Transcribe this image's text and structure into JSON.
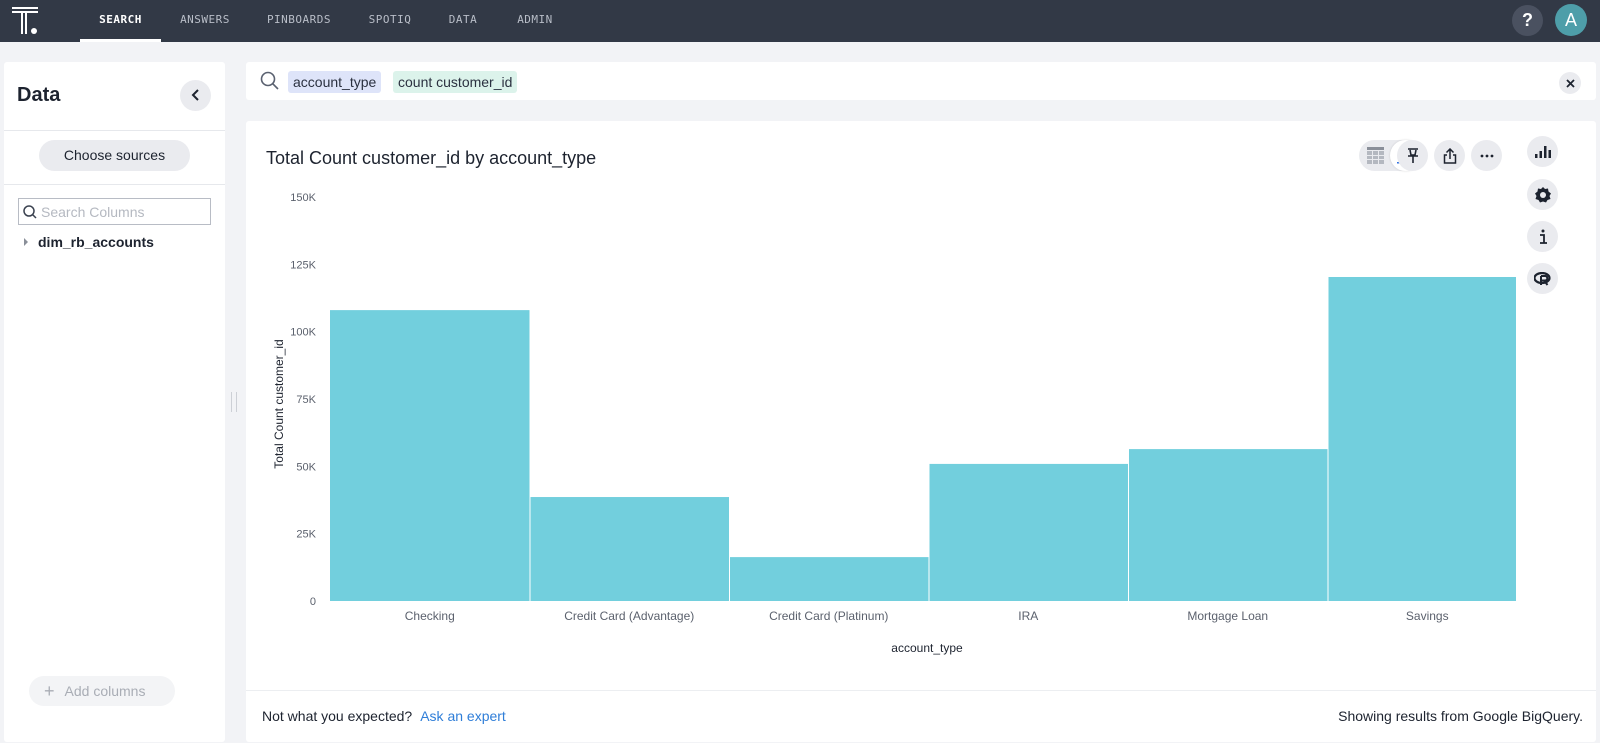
{
  "topnav": {
    "tabs": [
      {
        "label": "SEARCH",
        "active": true
      },
      {
        "label": "ANSWERS",
        "active": false
      },
      {
        "label": "PINBOARDS",
        "active": false
      },
      {
        "label": "SPOTIQ",
        "active": false
      },
      {
        "label": "DATA",
        "active": false
      },
      {
        "label": "ADMIN",
        "active": false
      }
    ],
    "help_label": "?",
    "avatar_initial": "A"
  },
  "sidebar": {
    "title": "Data",
    "choose_sources_label": "Choose sources",
    "search_placeholder": "Search Columns",
    "search_value": "",
    "tree_items": [
      {
        "label": "dim_rb_accounts"
      }
    ],
    "add_columns_label": "Add columns"
  },
  "searchbar": {
    "tokens": [
      {
        "label": "account_type",
        "kind": "attribute"
      },
      {
        "label": "count customer_id",
        "kind": "measure"
      }
    ]
  },
  "answer": {
    "title": "Total Count customer_id by account_type",
    "toolbar": {
      "view_modes": [
        "table-icon",
        "chart-icon"
      ],
      "active_view": "chart",
      "actions": [
        "pin-icon",
        "share-icon",
        "more-icon"
      ]
    },
    "side_panel": [
      "chart-type-icon",
      "gear-icon",
      "info-icon",
      "r-analysis-icon"
    ]
  },
  "chart_data": {
    "type": "bar",
    "title": "Total Count customer_id by account_type",
    "xlabel": "account_type",
    "ylabel": "Total Count customer_id",
    "categories": [
      "Checking",
      "Credit Card (Advantage)",
      "Credit Card (Platinum)",
      "IRA",
      "Mortgage Loan",
      "Savings"
    ],
    "values": [
      108000,
      38600,
      16300,
      50900,
      56400,
      120300
    ],
    "ylim": [
      0,
      150000
    ],
    "yticks": [
      0,
      25000,
      50000,
      75000,
      100000,
      125000,
      150000
    ],
    "ytick_labels": [
      "0",
      "25K",
      "50K",
      "75K",
      "100K",
      "125K",
      "150K"
    ],
    "bar_color": "#72cfdd",
    "grid": false,
    "legend": "none"
  },
  "footer": {
    "question": "Not what you expected?",
    "link": "Ask an expert",
    "source_note": "Showing results from Google BigQuery."
  }
}
